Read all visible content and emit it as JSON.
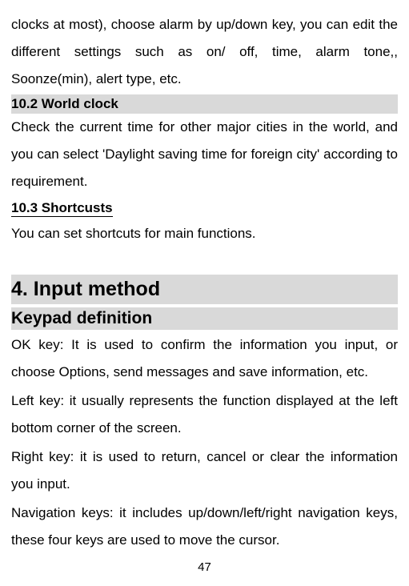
{
  "para1": "clocks at most), choose alarm by up/down key, you can edit the different settings such as on/ off, time, alarm tone,, Soonze(min), alert type, etc.",
  "sec_10_2_title": "10.2 World clock",
  "sec_10_2_body": "Check the current time for other major cities in the world, and you can select 'Daylight saving time for foreign city' according to requirement.",
  "sec_10_3_title": "10.3 Shortcusts",
  "sec_10_3_body": "You can set shortcuts for main functions.",
  "chapter_title": "4. Input method",
  "sub_title": "Keypad definition",
  "para_ok": "OK key: It is used to confirm the information you input, or choose Options, send messages and save information, etc.",
  "para_left": "Left key: it usually represents the function displayed at the left bottom corner of the screen.",
  "para_right": "Right key: it is used to return, cancel or clear the information you input.",
  "para_nav": "Navigation keys: it includes up/down/left/right navigation keys, these four keys are used to move the cursor.",
  "page_number": "47"
}
